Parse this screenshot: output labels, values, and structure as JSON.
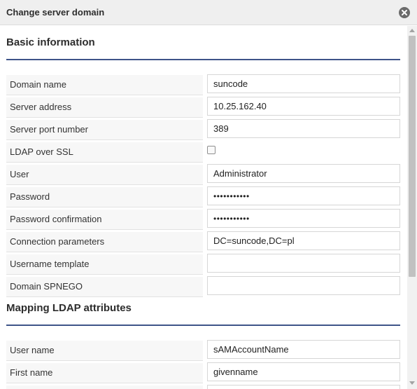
{
  "dialog": {
    "title": "Change server domain",
    "close_icon": "close-circle-icon"
  },
  "sections": {
    "basic": {
      "title": "Basic information",
      "domain_name": {
        "label": "Domain name",
        "value": "suncode"
      },
      "server_address": {
        "label": "Server address",
        "value": "10.25.162.40"
      },
      "server_port": {
        "label": "Server port number",
        "value": "389"
      },
      "ldap_ssl": {
        "label": "LDAP over SSL",
        "checked": false
      },
      "user": {
        "label": "User",
        "value": "Administrator"
      },
      "password": {
        "label": "Password",
        "value": "•••••••••••"
      },
      "password_confirmation": {
        "label": "Password confirmation",
        "value": "•••••••••••"
      },
      "connection_parameters": {
        "label": "Connection parameters",
        "value": "DC=suncode,DC=pl"
      },
      "username_template": {
        "label": "Username template",
        "value": ""
      },
      "domain_spnego": {
        "label": "Domain SPNEGO",
        "value": ""
      }
    },
    "mapping": {
      "title": "Mapping LDAP attributes",
      "user_name": {
        "label": "User name",
        "value": "sAMAccountName"
      },
      "first_name": {
        "label": "First name",
        "value": "givenname"
      }
    }
  },
  "colors": {
    "section_rule": "#3e5489",
    "titlebar_bg": "#efefef",
    "label_bg": "#f7f7f7"
  }
}
